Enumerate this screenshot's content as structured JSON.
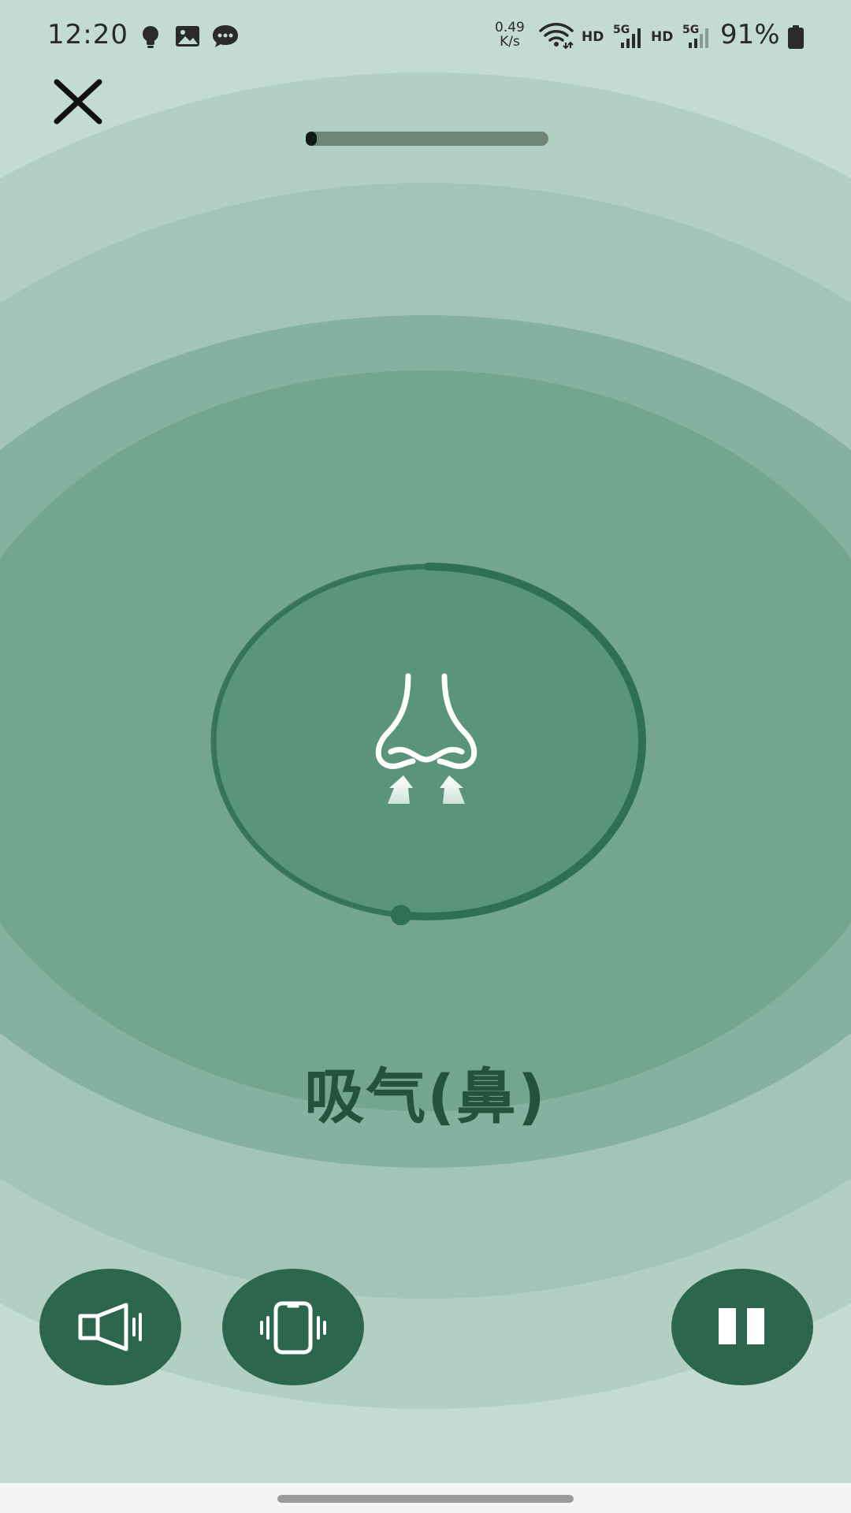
{
  "status_bar": {
    "time": "12:20",
    "notification_icons": [
      "bulb-icon",
      "image-icon",
      "chat-icon"
    ],
    "net_speed_value": "0.49",
    "net_speed_unit": "K/s",
    "hd_label_1": "HD",
    "hd_label_2": "HD",
    "sim_label_1": "5G",
    "sim_label_2": "5G",
    "battery": "91%"
  },
  "session": {
    "progress": 0.03
  },
  "breath": {
    "phase_label": "吸气(鼻)",
    "ring_progress": 0.52,
    "icon": "nose-inhale-icon"
  },
  "controls": {
    "sound_icon": "speaker-icon",
    "vibrate_icon": "vibrate-icon",
    "pause_icon": "pause-icon"
  },
  "colors": {
    "accent_dark": "#2c664f",
    "ring_stroke": "#2f6f55",
    "label_text": "#24523f",
    "background": "#c4dbd2"
  }
}
